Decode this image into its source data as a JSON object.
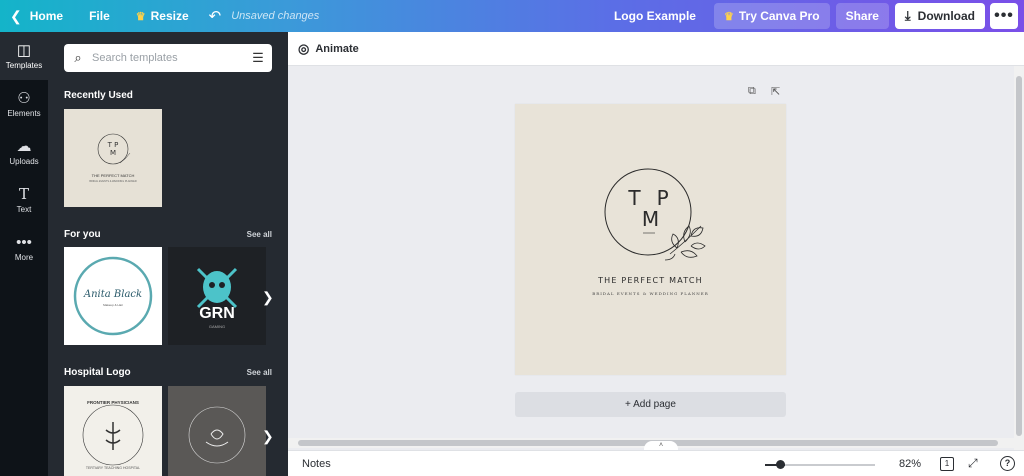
{
  "topbar": {
    "home": "Home",
    "file": "File",
    "resize": "Resize",
    "unsaved": "Unsaved changes",
    "title": "Logo Example",
    "try_pro": "Try Canva Pro",
    "share": "Share",
    "download": "Download",
    "more": "•••",
    "icons": {
      "back": "chevron-left-icon",
      "crown": "crown-icon",
      "undo": "undo-icon",
      "download": "download-icon"
    }
  },
  "sidenav": {
    "items": [
      {
        "label": "Templates",
        "icon": "templates-icon",
        "active": true
      },
      {
        "label": "Elements",
        "icon": "elements-icon"
      },
      {
        "label": "Uploads",
        "icon": "upload-cloud-icon"
      },
      {
        "label": "Text",
        "icon": "text-icon"
      },
      {
        "label": "More",
        "icon": "more-dots-icon"
      }
    ]
  },
  "panel": {
    "search_placeholder": "Search templates",
    "recently_used": "Recently Used",
    "for_you": "For you",
    "hospital_logo": "Hospital Logo",
    "see_all": "See all",
    "thumbs": {
      "recent_title": "THE PERFECT MATCH",
      "recent_sub": "BRIDAL EVENTS & WEDDING PLANNER",
      "anita_name": "Anita Black",
      "anita_sub": "Makeup & Hair",
      "grn_name": "GRN",
      "grn_sub": "GAMING",
      "frontier_top": "FRONTIER PHYSICIANS",
      "frontier_bottom": "TERTIARY TEACHING HOSPITAL"
    }
  },
  "toolbar": {
    "animate": "Animate"
  },
  "canvas": {
    "monogram_t": "T",
    "monogram_p": "P",
    "monogram_m": "M",
    "logo_title": "THE PERFECT MATCH",
    "logo_sub": "BRIDAL EVENTS & WEDDING PLANNER",
    "add_page": "+ Add page",
    "background_color": "#e8e3d8"
  },
  "bottombar": {
    "notes": "Notes",
    "zoom": "82%",
    "page_count": "1",
    "help": "?"
  },
  "colors": {
    "gradient_start": "#14b4c9",
    "gradient_end": "#7a4fe8",
    "sidenav_bg": "#0e1318",
    "panel_bg": "#252a31"
  }
}
